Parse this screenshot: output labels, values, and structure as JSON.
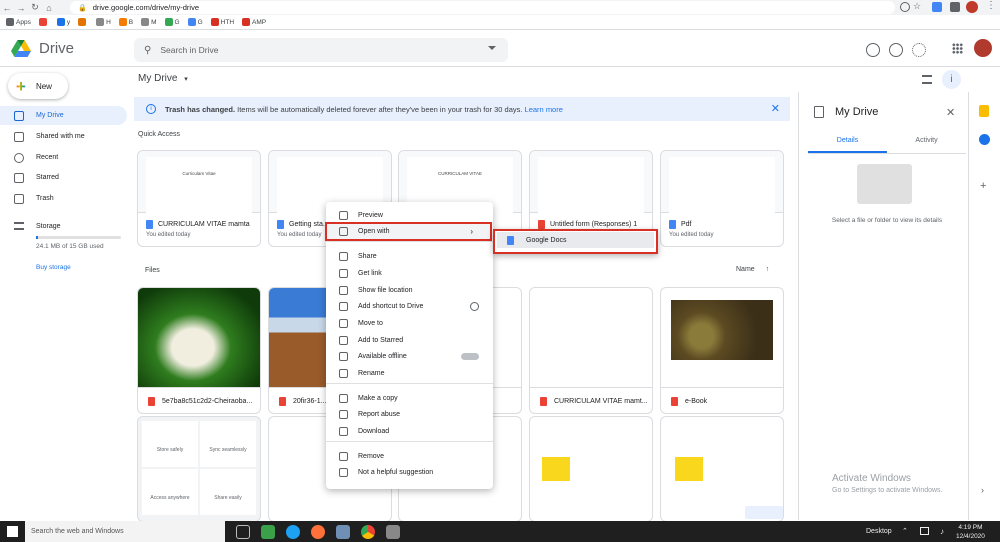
{
  "browser": {
    "url": "drive.google.com/drive/my-drive",
    "bookmarks": [
      {
        "label": "Apps",
        "color": "#5f6368"
      },
      {
        "label": "",
        "color": "#ea4335"
      },
      {
        "label": "y",
        "color": "#1a73e8"
      },
      {
        "label": "",
        "color": "#e37400"
      },
      {
        "label": "H",
        "color": "#888"
      },
      {
        "label": "B",
        "color": "#f57c00"
      },
      {
        "label": "M",
        "color": "#888"
      },
      {
        "label": "G",
        "color": "#34a853"
      },
      {
        "label": "G",
        "color": "#4285f4"
      },
      {
        "label": "HTH",
        "color": "#d93025"
      },
      {
        "label": "AMP",
        "color": "#d93025"
      }
    ]
  },
  "header": {
    "app_name": "Drive",
    "search_placeholder": "Search in Drive"
  },
  "sidebar": {
    "new_label": "New",
    "items": [
      {
        "label": "My Drive",
        "icon": "my-drive-icon"
      },
      {
        "label": "Shared with me",
        "icon": "people-icon"
      },
      {
        "label": "Recent",
        "icon": "clock-icon"
      },
      {
        "label": "Starred",
        "icon": "star-icon"
      },
      {
        "label": "Trash",
        "icon": "trash-icon"
      }
    ],
    "storage_label": "Storage",
    "storage_used": "24.1 MB of 15 GB used",
    "buy_storage": "Buy storage",
    "storage_fraction": 0.0016
  },
  "main": {
    "title": "My Drive",
    "banner": {
      "bold": "Trash has changed.",
      "text": "Items will be automatically deleted forever after they've been in your trash for 30 days.",
      "link": "Learn more"
    },
    "quick_access_label": "Quick Access",
    "quick_access": [
      {
        "name": "CURRICULAM VITAE mamta",
        "sub": "You edited today",
        "type": "doc",
        "thumb": "Curriculam Vitae"
      },
      {
        "name": "Getting sta...",
        "sub": "You edited today",
        "type": "doc",
        "thumb": ""
      },
      {
        "name": "",
        "sub": "",
        "type": "doc",
        "thumb": "CURRICULAM VITAE"
      },
      {
        "name": "Untitled form (Responses) 1",
        "sub": "",
        "type": "pdf",
        "thumb": ""
      },
      {
        "name": "Pdf",
        "sub": "You edited today",
        "type": "doc",
        "thumb": ""
      }
    ],
    "files_label": "Files",
    "sort_label": "Name",
    "files": [
      {
        "name": "5e7ba8c51c2d2-Cheiraoba...",
        "type": "img"
      },
      {
        "name": "20fir36-1...",
        "type": "img"
      },
      {
        "name": "...mamta",
        "type": "doc"
      },
      {
        "name": "CURRICULAM VITAE mamt...",
        "type": "pdf"
      },
      {
        "name": "e-Book",
        "type": "pdf"
      }
    ],
    "row3_texts": [
      "Store safely",
      "Sync seamlessly",
      "Access anywhere",
      "Share easily"
    ]
  },
  "context_menu": {
    "items": [
      {
        "label": "Preview",
        "icon": "eye-icon"
      },
      {
        "label": "Open with",
        "icon": "move-icon",
        "submenu": true
      },
      {
        "label": "Share",
        "icon": "add-person-icon"
      },
      {
        "label": "Get link",
        "icon": "link-icon"
      },
      {
        "label": "Show file location",
        "icon": "folder-icon"
      },
      {
        "label": "Add shortcut to Drive",
        "icon": "shortcut-icon"
      },
      {
        "label": "Move to",
        "icon": "move-to-icon"
      },
      {
        "label": "Add to Starred",
        "icon": "star-icon"
      },
      {
        "label": "Available offline",
        "icon": "offline-icon"
      },
      {
        "label": "Rename",
        "icon": "pencil-icon"
      },
      {
        "label": "Make a copy",
        "icon": "copy-icon"
      },
      {
        "label": "Report abuse",
        "icon": "report-icon"
      },
      {
        "label": "Download",
        "icon": "download-icon"
      },
      {
        "label": "Remove",
        "icon": "trash-icon"
      },
      {
        "label": "Not a helpful suggestion",
        "icon": "thumbs-down-icon"
      }
    ],
    "submenu_item": "Google Docs"
  },
  "details_panel": {
    "title": "My Drive",
    "tabs": [
      "Details",
      "Activity"
    ],
    "empty_text": "Select a file or folder to view its details"
  },
  "watermark": {
    "line1": "Activate Windows",
    "line2": "Go to Settings to activate Windows."
  },
  "taskbar": {
    "search_placeholder": "Search the web and Windows",
    "desktop_label": "Desktop",
    "time": "4:19 PM",
    "date": "12/4/2020"
  },
  "colors": {
    "accent": "#1a73e8",
    "highlight_border": "#d93025",
    "banner_bg": "#e8f0fe"
  }
}
